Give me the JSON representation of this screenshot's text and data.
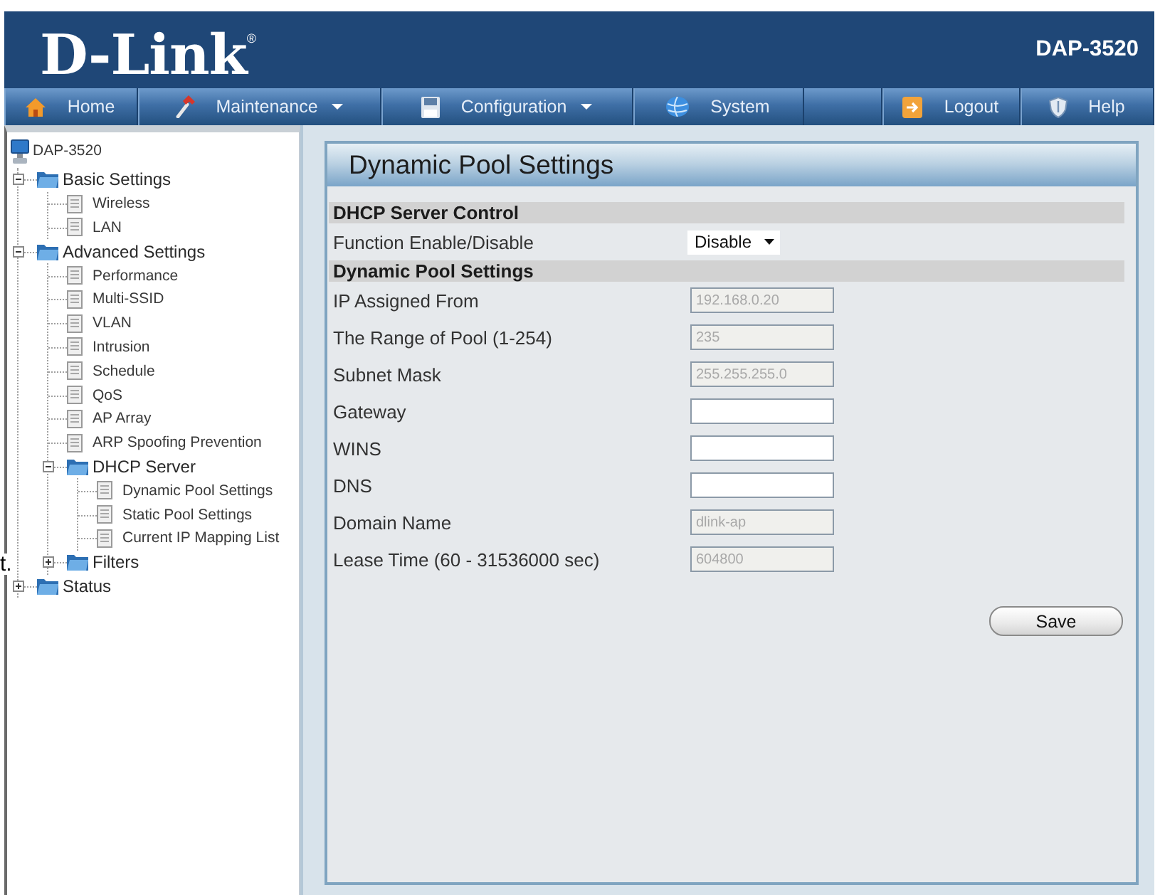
{
  "header": {
    "logo": "D-Link$^{®}$",
    "model": "DAP-3520"
  },
  "nav": [
    {
      "label": "Home",
      "menu": false
    },
    {
      "label": "Maintenance",
      "menu": true
    },
    {
      "label": "Configuration",
      "menu": true
    },
    {
      "label": "System",
      "menu": false
    },
    {
      "label": "Logout",
      "menu": false
    },
    {
      "label": "Help",
      "menu": false
    }
  ],
  "tree": {
    "label": "DAP-3520",
    "kind": "device",
    "children": [
      {
        "label": "Basic Settings",
        "kind": "folder",
        "expanded": true,
        "children": [
          {
            "label": "Wireless",
            "kind": "page"
          },
          {
            "label": "LAN",
            "kind": "page"
          }
        ]
      },
      {
        "label": "Advanced Settings",
        "kind": "folder",
        "expanded": true,
        "children": [
          {
            "label": "Performance",
            "kind": "page"
          },
          {
            "label": "Multi-SSID",
            "kind": "page"
          },
          {
            "label": "VLAN",
            "kind": "page"
          },
          {
            "label": "Intrusion",
            "kind": "page"
          },
          {
            "label": "Schedule",
            "kind": "page"
          },
          {
            "label": "QoS",
            "kind": "page"
          },
          {
            "label": "AP Array",
            "kind": "page"
          },
          {
            "label": "ARP Spoofing Prevention",
            "kind": "page"
          },
          {
            "label": "DHCP Server",
            "kind": "folder",
            "expanded": true,
            "children": [
              {
                "label": "Dynamic Pool Settings",
                "kind": "page"
              },
              {
                "label": "Static Pool Settings",
                "kind": "page"
              },
              {
                "label": "Current IP Mapping List",
                "kind": "page"
              }
            ]
          },
          {
            "label": "Filters",
            "kind": "folder",
            "expanded": false
          }
        ]
      },
      {
        "label": "Status",
        "kind": "folder",
        "expanded": false
      }
    ]
  },
  "edge_fragment": "t.",
  "panel": {
    "title": "Dynamic Pool Settings",
    "sections": [
      {
        "title": "DHCP Server Control",
        "rows": [
          {
            "label": "Function Enable/Disable",
            "kind": "select",
            "value": "Disable",
            "disabled": false
          }
        ]
      },
      {
        "title": "Dynamic Pool Settings",
        "rows": [
          {
            "label": "IP Assigned From",
            "kind": "text",
            "value": "192.168.0.20",
            "disabled": true
          },
          {
            "label": "The Range of Pool (1-254)",
            "kind": "text",
            "value": "235",
            "disabled": true
          },
          {
            "label": "Subnet Mask",
            "kind": "text",
            "value": "255.255.255.0",
            "disabled": true
          },
          {
            "label": "Gateway",
            "kind": "text",
            "disabled": false
          },
          {
            "label": "WINS",
            "kind": "text",
            "disabled": false
          },
          {
            "label": "DNS",
            "kind": "text",
            "disabled": false
          },
          {
            "label": "Domain Name",
            "kind": "text",
            "value": "dlink-ap",
            "disabled": true
          },
          {
            "label": "Lease Time (60 - 31536000 sec)",
            "kind": "text",
            "value": "604800",
            "disabled": true
          }
        ]
      }
    ],
    "save": "Save"
  }
}
